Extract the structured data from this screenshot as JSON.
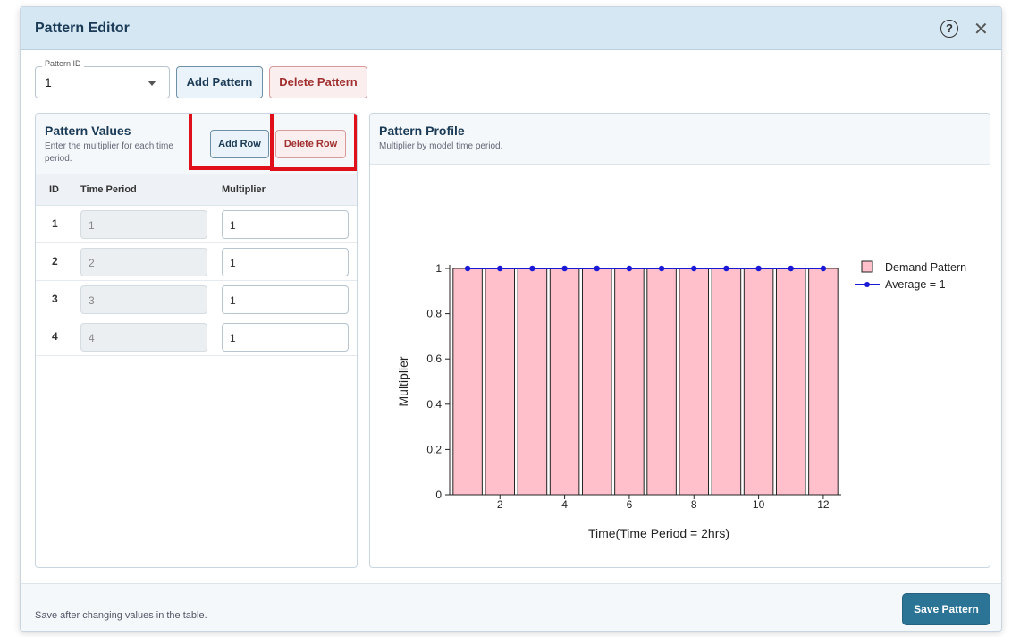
{
  "dialog": {
    "title": "Pattern Editor",
    "help_icon": "?",
    "close_icon": "✕"
  },
  "pattern_select": {
    "label": "Pattern ID",
    "value": "1"
  },
  "toolbar": {
    "add_pattern": "Add Pattern",
    "delete_pattern": "Delete Pattern"
  },
  "values_panel": {
    "title": "Pattern Values",
    "subtitle": "Enter the multiplier for each time period.",
    "add_row": "Add Row",
    "delete_row": "Delete Row",
    "columns": [
      "ID",
      "Time Period",
      "Multiplier"
    ],
    "rows": [
      {
        "id": "1",
        "time_period": "1",
        "multiplier": "1"
      },
      {
        "id": "2",
        "time_period": "2",
        "multiplier": "1"
      },
      {
        "id": "3",
        "time_period": "3",
        "multiplier": "1"
      },
      {
        "id": "4",
        "time_period": "4",
        "multiplier": "1"
      }
    ]
  },
  "profile_panel": {
    "title": "Pattern Profile",
    "subtitle": "Multiplier by model time period."
  },
  "chart_data": {
    "type": "bar",
    "x": [
      1,
      2,
      3,
      4,
      5,
      6,
      7,
      8,
      9,
      10,
      11,
      12
    ],
    "series": [
      {
        "name": "Demand Pattern",
        "type": "bar",
        "values": [
          1,
          1,
          1,
          1,
          1,
          1,
          1,
          1,
          1,
          1,
          1,
          1
        ],
        "color": "#ffc0cb"
      },
      {
        "name": "Average = 1",
        "type": "line",
        "values": [
          1,
          1,
          1,
          1,
          1,
          1,
          1,
          1,
          1,
          1,
          1,
          1
        ],
        "color": "#1a1ad6"
      }
    ],
    "xlabel": "Time(Time Period = 2hrs)",
    "ylabel": "Multiplier",
    "xticks": [
      "2",
      "4",
      "6",
      "8",
      "10",
      "12"
    ],
    "yticks": [
      "0",
      "0.2",
      "0.4",
      "0.6",
      "0.8",
      "1"
    ],
    "ylim": [
      0,
      1
    ],
    "legend_position": "top-right",
    "grid": false
  },
  "footer": {
    "note": "Save after changing values in the table.",
    "save": "Save Pattern"
  }
}
